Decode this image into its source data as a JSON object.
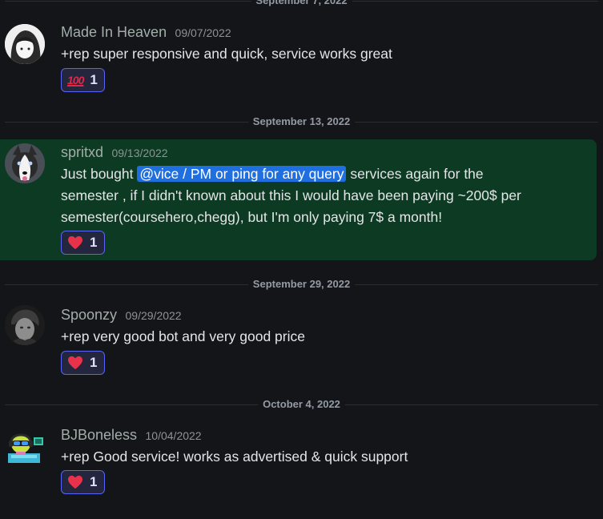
{
  "dividers": {
    "d0": "September 7, 2022",
    "d1": "September 13, 2022",
    "d2": "September 29, 2022",
    "d3": "October 4, 2022"
  },
  "messages": [
    {
      "username": "Made In Heaven",
      "timestamp": "09/07/2022",
      "text": "+rep super responsive and quick, service works great",
      "reaction": {
        "emoji": "100-emoji-icon",
        "emoji_text": "100",
        "count": "1"
      }
    },
    {
      "username": "spritxd",
      "timestamp": "09/13/2022",
      "text_before": "Just bought ",
      "mention": "@vice / PM or ping for any query",
      "text_after": " services again for the semester , if I didn't known about this I would have been paying ~200$ per semester(coursehero,chegg), but I'm only paying 7$ a month!",
      "reaction": {
        "emoji": "heart-icon",
        "count": "1"
      }
    },
    {
      "username": "Spoonzy",
      "timestamp": "09/29/2022",
      "text": "+rep very good bot and very good price",
      "reaction": {
        "emoji": "heart-icon",
        "count": "1"
      }
    },
    {
      "username": "BJBoneless",
      "timestamp": "10/04/2022",
      "text": "+rep Good service! works as advertised & quick support",
      "reaction": {
        "emoji": "heart-icon",
        "count": "1"
      }
    }
  ],
  "colors": {
    "background": "#131519",
    "highlight": "#0d3a22",
    "mention": "#1f6fe0",
    "reaction_border": "#5865f2",
    "heart": "#e8324a"
  }
}
